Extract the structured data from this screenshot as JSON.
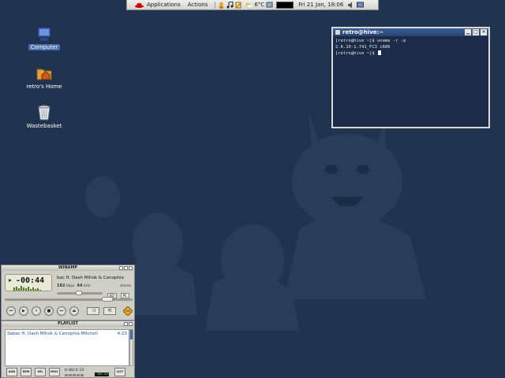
{
  "panel": {
    "applications": "Applications",
    "actions": "Actions",
    "weather": "6°C",
    "clock": "Fri 21 Jan, 18:06"
  },
  "desktop": {
    "icons": [
      {
        "label": "Computer",
        "icon": "computer-icon"
      },
      {
        "label": "retro's Home",
        "icon": "home-folder-icon"
      },
      {
        "label": "Wastebasket",
        "icon": "trash-icon"
      }
    ]
  },
  "terminal": {
    "title": "retro@hive:~",
    "lines": [
      "[retro@hive ~]$ uname -r -p",
      "2.6.10-1.741_FC3 i686",
      "[retro@hive ~]$ "
    ]
  },
  "winamp": {
    "title": "WINAMP",
    "time": "-00:44",
    "song": "bac ft. Dash Mihok & Cenophia",
    "kbps": "192",
    "kbps_unit": "kbps",
    "khz": "44",
    "khz_unit": "kHz",
    "channels": "stereo",
    "eq": "EQ",
    "pl": "PL",
    "position": 0.83
  },
  "playlist": {
    "title": "PLAYLIST",
    "items": [
      {
        "title": "Sabac ft. Dash Mihok & Cenophia Mitchell",
        "length": "4:23"
      }
    ],
    "buttons": [
      "ADD",
      "REM",
      "SEL",
      "MISC",
      "LIST"
    ],
    "time_total": "0:00/4:23",
    "time_remaining": "-00:44"
  },
  "colors": {
    "desktop": "#21334f",
    "titlebar": "#3c5f97",
    "selection": "#4a6fb0"
  }
}
